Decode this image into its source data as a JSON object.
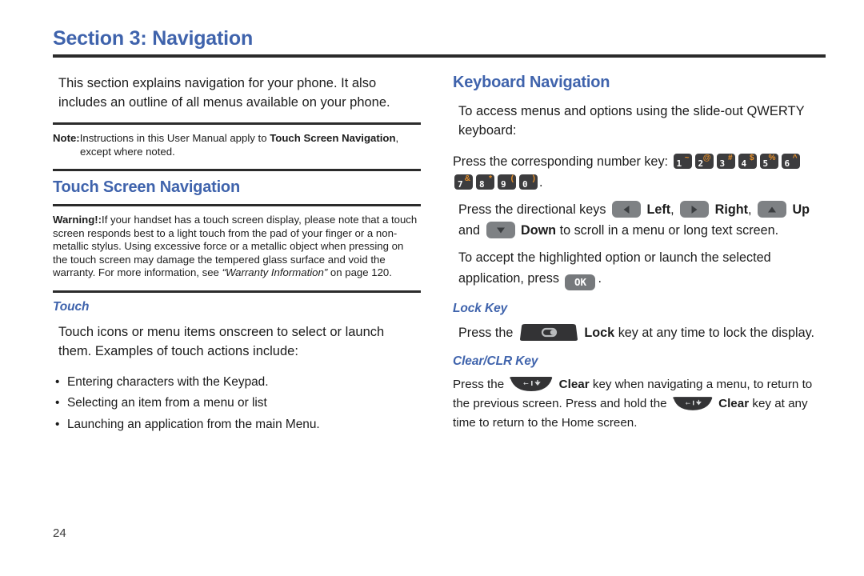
{
  "section": {
    "title": "Section 3: Navigation"
  },
  "left": {
    "intro": "This section explains navigation for your phone. It also includes an outline of all menus available on your phone.",
    "note": {
      "lead": "Note:",
      "line1_a": "Instructions in this User Manual apply to ",
      "line1_bold": "Touch Screen Navigation",
      "line1_b": ",",
      "line2": "except where noted."
    },
    "touch_screen_nav_heading": "Touch Screen Navigation",
    "warning": {
      "lead": "Warning!:",
      "text": "If your handset has a touch screen display, please note that a touch screen responds best to a light touch from the pad of your finger or a non-metallic stylus. Using excessive force or a metallic object when pressing on the touch screen may damage the tempered glass surface and void the warranty. For more information, see ",
      "italic_ref": "“Warranty Information”",
      "text_end": " on page 120."
    },
    "touch_heading": "Touch",
    "touch_body": "Touch icons or menu items onscreen to select or launch them. Examples of touch actions include:",
    "bullets": [
      "Entering characters with the Keypad.",
      "Selecting an item from a menu or list",
      "Launching an application from the main Menu."
    ]
  },
  "right": {
    "keyboard_nav_heading": "Keyboard Navigation",
    "keyboard_intro": "To access menus and options using the slide-out QWERTY keyboard:",
    "press_number_key": "Press the corresponding number key:",
    "number_keys": [
      {
        "digit": "1",
        "symbol": "~"
      },
      {
        "digit": "2",
        "symbol": "@"
      },
      {
        "digit": "3",
        "symbol": "#"
      },
      {
        "digit": "4",
        "symbol": "$"
      },
      {
        "digit": "5",
        "symbol": "%"
      },
      {
        "digit": "6",
        "symbol": "^"
      },
      {
        "digit": "7",
        "symbol": "&"
      },
      {
        "digit": "8",
        "symbol": "*"
      },
      {
        "digit": "9",
        "symbol": "("
      },
      {
        "digit": "0",
        "symbol": ")"
      }
    ],
    "number_keys_period": ".",
    "directional": {
      "lead": "Press the directional keys",
      "left_label": "Left",
      "comma1": ",",
      "right_label": "Right",
      "comma2": ",",
      "up_label": "Up",
      "and_word": "and",
      "down_label": "Down",
      "tail": "to scroll in a menu or long text screen."
    },
    "accept": {
      "text": "To accept the highlighted option or launch the selected application, press",
      "ok_label": "OK",
      "period": "."
    },
    "lock_key_heading": "Lock Key",
    "lock_key": {
      "press": "Press the",
      "bold": "Lock",
      "tail": "key at any time to lock the display."
    },
    "clear_key_heading": "Clear/CLR Key",
    "clear_key": {
      "press": "Press the",
      "bold1": "Clear",
      "mid": "key when navigating a menu, to return to the previous screen. Press and hold the",
      "bold2": "Clear",
      "tail": "key at any time to return to the Home screen."
    }
  },
  "footer": {
    "page_number": "24"
  },
  "colors": {
    "heading_blue": "#3f63ac",
    "rule_dark": "#2b2b2b",
    "numkey_bg": "#3c3c3e",
    "numkey_symbol": "#e8902a",
    "dirkey_bg": "#7e8184",
    "okkey_bg": "#76797c",
    "hardkey_dark": "#333335"
  }
}
